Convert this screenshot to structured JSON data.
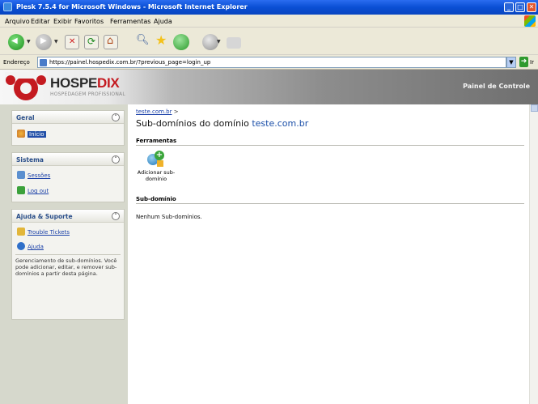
{
  "window": {
    "title": "Plesk 7.5.4 for Microsoft Windows - Microsoft Internet Explorer"
  },
  "menubar": {
    "items": [
      "Arquivo",
      "Editar",
      "Exibir",
      "Favoritos",
      "Ferramentas",
      "Ajuda"
    ]
  },
  "addressbar": {
    "label": "Endereço",
    "url": "https://painel.hospedix.com.br/?previous_page=login_up",
    "go_label": "Ir"
  },
  "header": {
    "brand_part1": "HOSPE",
    "brand_part2": "DIX",
    "brand_sub": "HOSPEDAGEM PROFISSIONAL",
    "panel_title": "Painel de Controle"
  },
  "sidebar": {
    "geral": {
      "title": "Geral",
      "items": [
        {
          "label": "Início"
        }
      ]
    },
    "sistema": {
      "title": "Sistema",
      "items": [
        {
          "label": "Sessões"
        },
        {
          "label": "Log out"
        }
      ]
    },
    "ajuda": {
      "title": "Ajuda & Suporte",
      "items": [
        {
          "label": "Trouble Tickets"
        },
        {
          "label": "Ajuda"
        }
      ],
      "help_text": "Gerenciamento de sub-domínios. Você pode adicionar, editar, e remover sub-domínios a partir desta página."
    }
  },
  "main": {
    "breadcrumb_link": "teste.com.br",
    "breadcrumb_sep": ">",
    "title_prefix": "Sub-domínios do domínio",
    "title_domain": "teste.com.br",
    "tools_section": "Ferramentas",
    "tool_add_label": "Adicionar sub-domínio",
    "subdomain_section": "Sub-domínio",
    "empty_message": "Nenhum Sub-domínios."
  }
}
